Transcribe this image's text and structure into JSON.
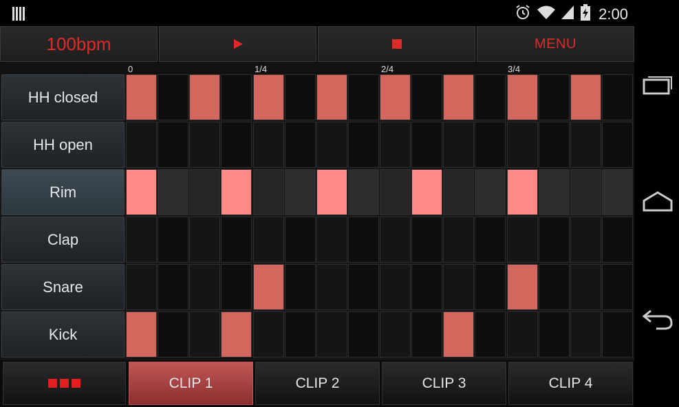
{
  "status": {
    "time": "2:00"
  },
  "toolbar": {
    "bpm": "100bpm",
    "menu": "MENU"
  },
  "ruler": {
    "m0": "0",
    "m1": "1/4",
    "m2": "2/4",
    "m3": "3/4"
  },
  "tracks": [
    {
      "name": "HH closed",
      "steps": [
        1,
        0,
        1,
        0,
        1,
        0,
        1,
        0,
        1,
        0,
        1,
        0,
        1,
        0,
        1,
        0
      ]
    },
    {
      "name": "HH open",
      "steps": [
        0,
        0,
        0,
        0,
        0,
        0,
        0,
        0,
        0,
        0,
        0,
        0,
        0,
        0,
        0,
        0
      ]
    },
    {
      "name": "Rim",
      "steps": [
        1,
        0,
        0,
        1,
        0,
        0,
        1,
        0,
        0,
        1,
        0,
        0,
        1,
        0,
        0,
        0
      ]
    },
    {
      "name": "Clap",
      "steps": [
        0,
        0,
        0,
        0,
        0,
        0,
        0,
        0,
        0,
        0,
        0,
        0,
        0,
        0,
        0,
        0
      ]
    },
    {
      "name": "Snare",
      "steps": [
        0,
        0,
        0,
        0,
        1,
        0,
        0,
        0,
        0,
        0,
        0,
        0,
        1,
        0,
        0,
        0
      ]
    },
    {
      "name": "Kick",
      "steps": [
        1,
        0,
        0,
        1,
        0,
        0,
        0,
        0,
        0,
        0,
        1,
        0,
        0,
        0,
        0,
        0
      ]
    }
  ],
  "selected_track": 2,
  "clips": [
    "CLIP 1",
    "CLIP 2",
    "CLIP 3",
    "CLIP 4"
  ],
  "active_clip": 0,
  "colors": {
    "accent": "#e02a2a",
    "step_on": "#d4675d",
    "step_on_selected": "#ff8a88",
    "clip_active": "#c25656"
  }
}
